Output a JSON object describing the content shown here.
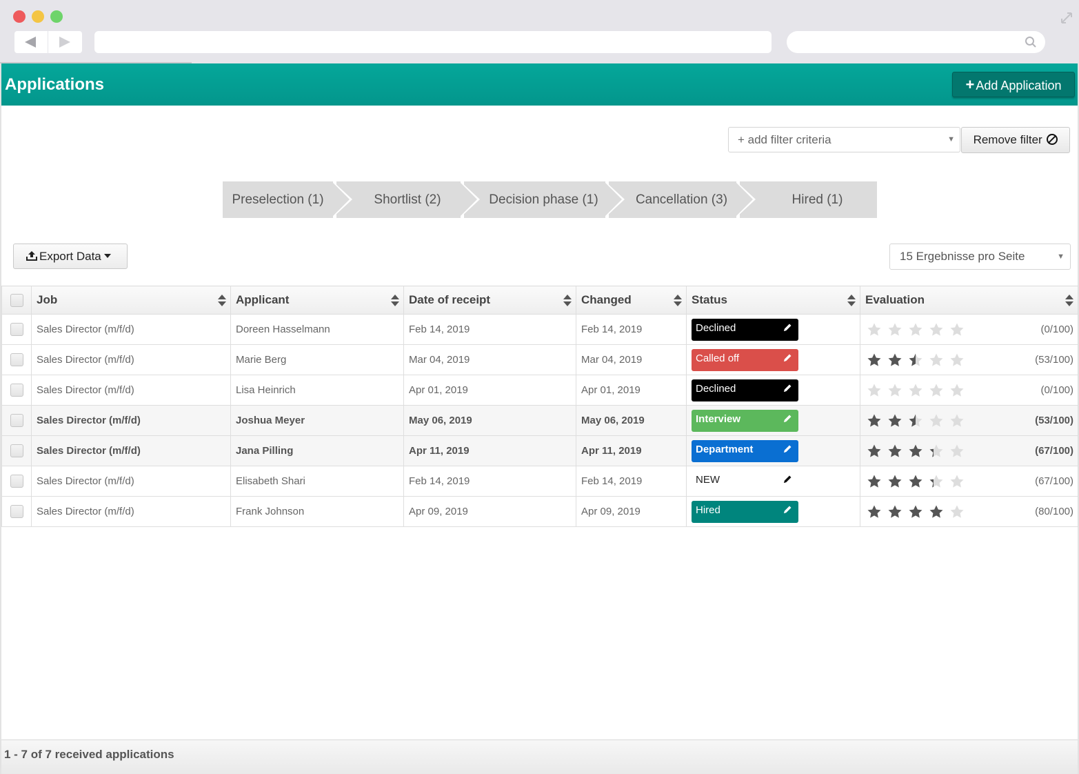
{
  "app": {
    "title": "Applications",
    "add_button": "Add Application"
  },
  "filters": {
    "add_criteria": "+ add filter criteria",
    "remove_filter": "Remove filter"
  },
  "pipeline": [
    {
      "label": "Preselection (1)"
    },
    {
      "label": "Shortlist (2)"
    },
    {
      "label": "Decision phase (1)"
    },
    {
      "label": "Cancellation (3)"
    },
    {
      "label": "Hired (1)"
    }
  ],
  "toolbar": {
    "export_label": "Export Data",
    "per_page": "15 Ergebnisse pro Seite"
  },
  "table": {
    "columns": [
      "Job",
      "Applicant",
      "Date of receipt",
      "Changed",
      "Status",
      "Evaluation"
    ],
    "rows": [
      {
        "job": "Sales Director (m/f/d)",
        "applicant": "Doreen Hasselmann",
        "received": "Feb 14, 2019",
        "changed": "Feb 14, 2019",
        "status": "Declined",
        "status_color": "#000000",
        "stars": 0,
        "score": "(0/100)",
        "bold": false
      },
      {
        "job": "Sales Director (m/f/d)",
        "applicant": "Marie Berg",
        "received": "Mar 04, 2019",
        "changed": "Mar 04, 2019",
        "status": "Called off",
        "status_color": "#da4f4a",
        "stars": 2.5,
        "score": "(53/100)",
        "bold": false
      },
      {
        "job": "Sales Director (m/f/d)",
        "applicant": "Lisa Heinrich",
        "received": "Apr 01, 2019",
        "changed": "Apr 01, 2019",
        "status": "Declined",
        "status_color": "#000000",
        "stars": 0,
        "score": "(0/100)",
        "bold": false
      },
      {
        "job": "Sales Director (m/f/d)",
        "applicant": "Joshua Meyer",
        "received": "May 06, 2019",
        "changed": "May 06, 2019",
        "status": "Interview",
        "status_color": "#5cb85c",
        "stars": 2.5,
        "score": "(53/100)",
        "bold": true
      },
      {
        "job": "Sales Director (m/f/d)",
        "applicant": "Jana Pilling",
        "received": "Apr 11, 2019",
        "changed": "Apr 11, 2019",
        "status": "Department",
        "status_color": "#0a6fd2",
        "stars": 3.3,
        "score": "(67/100)",
        "bold": true
      },
      {
        "job": "Sales Director (m/f/d)",
        "applicant": "Elisabeth Shari",
        "received": "Feb 14, 2019",
        "changed": "Feb 14, 2019",
        "status": "NEW",
        "status_color": "transparent",
        "stars": 3.3,
        "score": "(67/100)",
        "bold": false
      },
      {
        "job": "Sales Director (m/f/d)",
        "applicant": "Frank Johnson",
        "received": "Apr 09, 2019",
        "changed": "Apr 09, 2019",
        "status": "Hired",
        "status_color": "#00857d",
        "stars": 4,
        "score": "(80/100)",
        "bold": false
      }
    ]
  },
  "footer": {
    "summary": "1 - 7 of 7 received applications"
  },
  "colors": {
    "brand": "#05a79a",
    "add_button": "#03776e",
    "star_filled": "#555555",
    "star_empty": "#dddddd"
  },
  "icons": [
    "search-icon",
    "back-arrow-icon",
    "forward-arrow-icon",
    "resize-icon",
    "plus-icon",
    "ban-icon",
    "upload-icon",
    "caret-down-icon",
    "sort-icon",
    "pencil-icon",
    "star-icon"
  ]
}
